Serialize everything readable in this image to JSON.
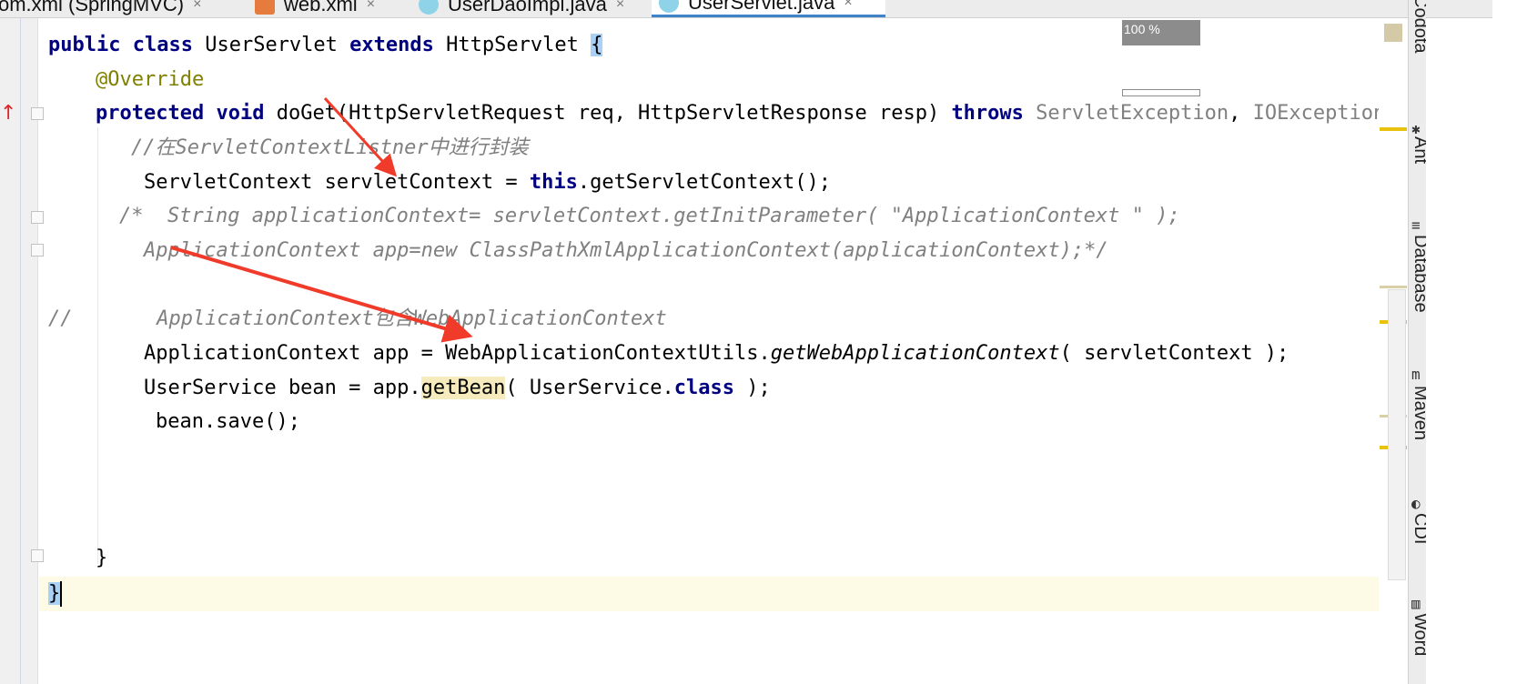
{
  "tabs": [
    {
      "label": "om.xml (SpringMVC)",
      "close": "×",
      "active": false
    },
    {
      "label": "web.xml",
      "close": "×",
      "active": false
    },
    {
      "label": "UserDaoImpl.java",
      "close": "×",
      "active": false
    },
    {
      "label": "UserServlet.java",
      "close": "×",
      "active": true
    }
  ],
  "zoom": {
    "label": "100 %"
  },
  "code": {
    "l1": {
      "kw1": "public",
      "kw2": "class",
      "name": "UserServlet",
      "kw3": "extends",
      "parent": "HttpServlet",
      "brace": "{"
    },
    "l2": {
      "annotation": "@Override"
    },
    "l3": {
      "kw1": "protected",
      "kw2": "void",
      "sig": "doGet(HttpServletRequest req, HttpServletResponse resp)",
      "kw3": "throws",
      "ex1": "ServletException",
      "sep": ",",
      "ex2": "IOException",
      "brace": "{"
    },
    "l4": {
      "comment": "//在ServletContextListner中进行封装"
    },
    "l5": {
      "pre": "ServletContext servletContext = ",
      "kw": "this",
      "post": ".getServletContext();"
    },
    "l6": {
      "comment": "/*  String applicationContext= servletContext.getInitParameter( \"ApplicationContext \" );"
    },
    "l7": {
      "comment": "ApplicationContext app=new ClassPathXmlApplicationContext(applicationContext);*/"
    },
    "l8": {
      "comment": "//       ApplicationContext包含WebApplicationContext"
    },
    "l9": {
      "pre": "ApplicationContext app = WebApplicationContextUtils.",
      "method": "getWebApplicationContext",
      "post": "( servletContext );"
    },
    "l10": {
      "pre": "UserService bean = app.",
      "method": "getBean",
      "mid": "( UserService.",
      "kw": "class",
      "post": " );"
    },
    "l11": {
      "text": "bean.save();"
    },
    "l12": {
      "text": "}"
    },
    "l13": {
      "text": "}"
    }
  },
  "tool_windows": [
    "Codota",
    "Ant",
    "Database",
    "Maven",
    "CDI",
    "Word"
  ],
  "colors": {
    "keyword": "#000080",
    "annotation": "#808000",
    "comment": "#808080",
    "arrow": "#f03a2a",
    "stripe": "#e8c20f"
  }
}
